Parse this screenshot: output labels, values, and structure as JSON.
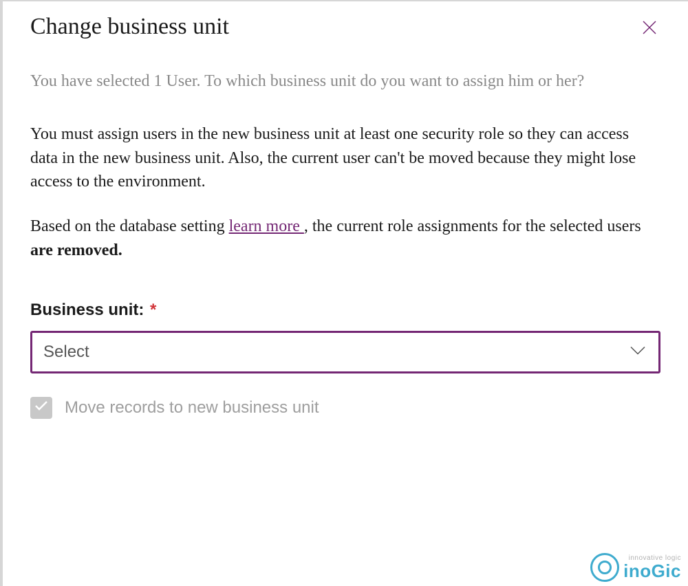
{
  "dialog": {
    "title": "Change business unit",
    "intro": "You have selected 1 User. To which business unit do you want to assign him or her?",
    "body": "You must assign users in the new business unit at least one security role so they can access data in the new business unit. Also, the current user can't be moved because they might lose access to the environment.",
    "setting_prefix": "Based on the database setting ",
    "learn_more": "learn more ",
    "setting_mid": ", the current role assignments for the selected users ",
    "setting_bold": "are removed."
  },
  "field": {
    "label": "Business unit:",
    "required_mark": "*",
    "placeholder": "Select"
  },
  "checkbox": {
    "label": "Move records to new business unit"
  },
  "watermark": {
    "tag": "innovative logic",
    "brand": "inoGic"
  }
}
